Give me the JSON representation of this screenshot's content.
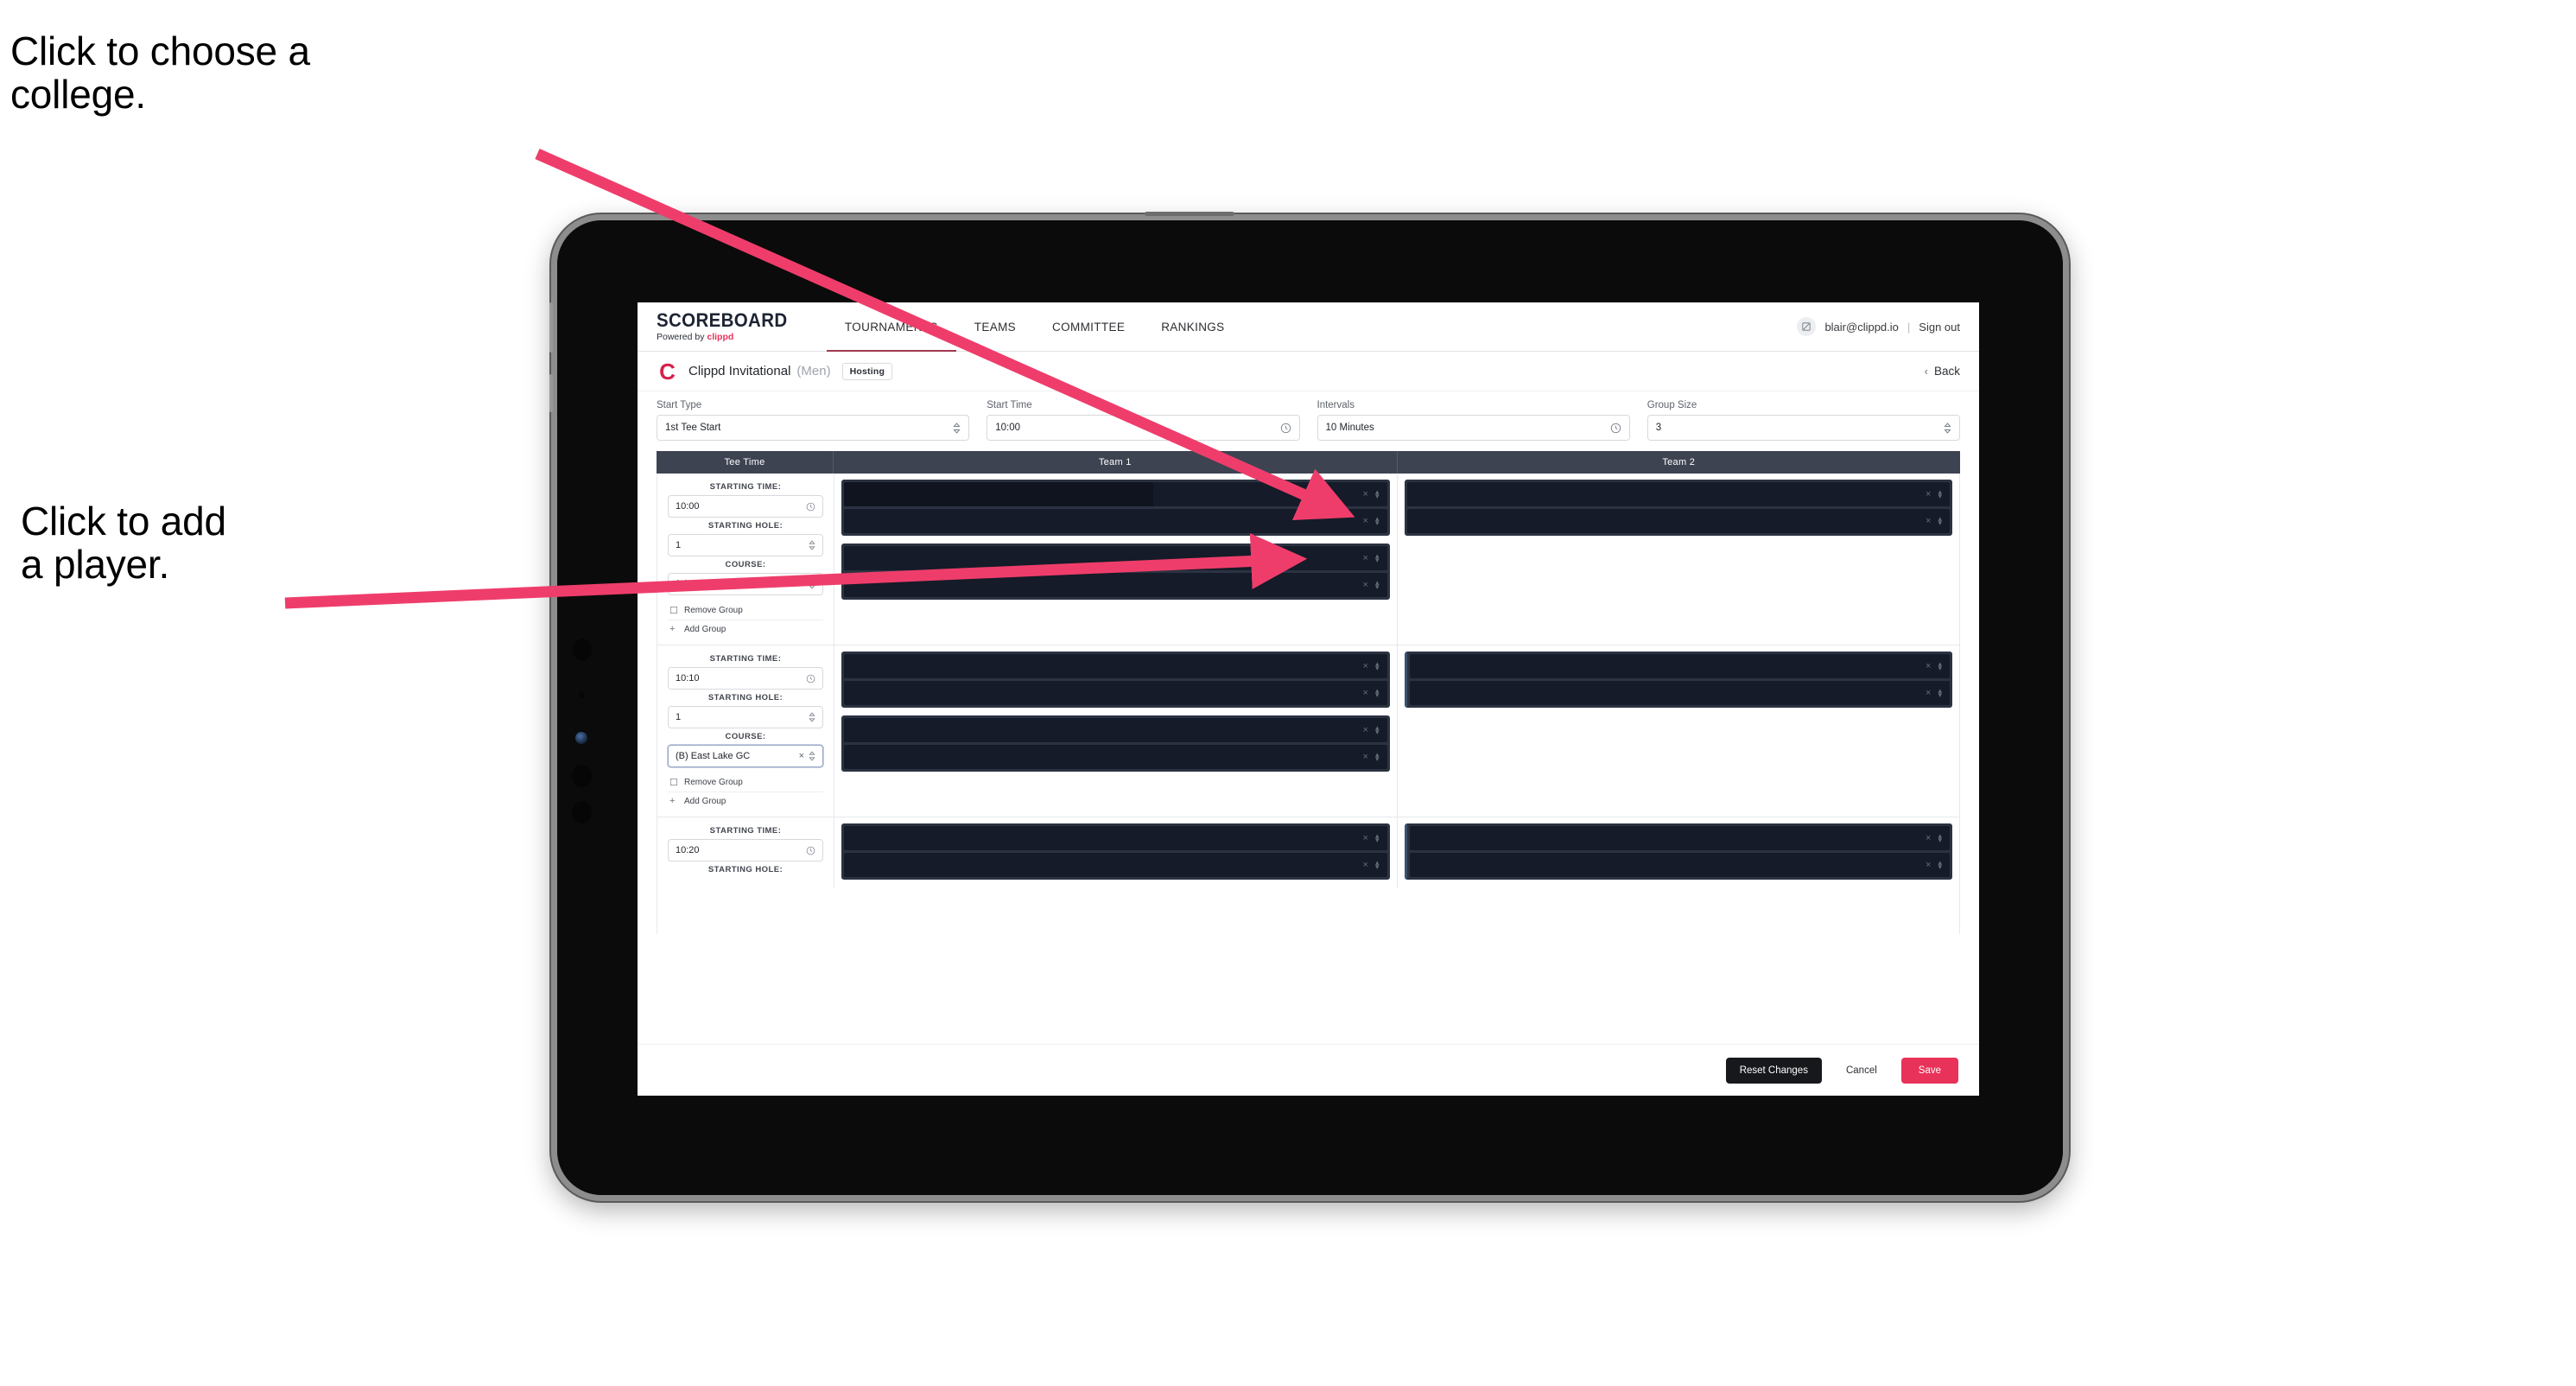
{
  "annotations": {
    "college": "Click to choose a\ncollege.",
    "player": "Click to add\na player."
  },
  "brand": {
    "name": "SCOREBOARD",
    "powered_prefix": "Powered by ",
    "powered_brand": "clippd"
  },
  "topnav": {
    "tabs": [
      {
        "label": "TOURNAMENTS",
        "active": true
      },
      {
        "label": "TEAMS",
        "active": false
      },
      {
        "label": "COMMITTEE",
        "active": false
      },
      {
        "label": "RANKINGS",
        "active": false
      }
    ],
    "avatar_icon": "user-avatar-icon",
    "email": "blair@clippd.io",
    "divider": "|",
    "signout": "Sign out"
  },
  "subheader": {
    "logo_letter": "C",
    "title": "Clippd Invitational",
    "gender": "(Men)",
    "chip": "Hosting",
    "back_chevron": "‹",
    "back_label": "Back"
  },
  "controls": [
    {
      "label": "Start Type",
      "value": "1st Tee Start",
      "icon": "chevron-updown-icon"
    },
    {
      "label": "Start Time",
      "value": "10:00",
      "icon": "clock-icon"
    },
    {
      "label": "Intervals",
      "value": "10 Minutes",
      "icon": "clock-icon"
    },
    {
      "label": "Group Size",
      "value": "3",
      "icon": "chevron-updown-icon"
    }
  ],
  "table": {
    "headers": [
      "Tee Time",
      "Team 1",
      "Team 2"
    ],
    "labels": {
      "starting_time": "STARTING TIME:",
      "starting_hole": "STARTING HOLE:",
      "course": "COURSE:",
      "remove_group": "Remove Group",
      "add_group": "Add Group",
      "remove_icon": "trash-icon",
      "add_icon": "plus-icon",
      "clock_icon": "clock-icon",
      "stepper_icon": "chevron-updown-icon",
      "clear_icon": "close-x-icon"
    },
    "groups": [
      {
        "starting_time": "10:00",
        "starting_hole": "1",
        "course": "(A) Peachtree GC",
        "course_focused": false,
        "team1": [
          {
            "slots": 2,
            "redact_widths": [
              57,
              0
            ],
            "focused": false
          },
          {
            "slots": 2,
            "redact_widths": [
              0,
              0
            ],
            "focused": false
          }
        ],
        "team2": [
          {
            "slots": 2,
            "redact_widths": [
              0,
              0
            ],
            "focused": false
          }
        ]
      },
      {
        "starting_time": "10:10",
        "starting_hole": "1",
        "course": "(B) East Lake GC",
        "course_focused": true,
        "team1": [
          {
            "slots": 2,
            "redact_widths": [
              0,
              0
            ],
            "focused": false
          },
          {
            "slots": 2,
            "redact_widths": [
              0,
              0
            ],
            "focused": false
          }
        ],
        "team2": [
          {
            "slots": 2,
            "redact_widths": [
              0,
              0
            ],
            "focused": true
          }
        ]
      },
      {
        "starting_time": "10:20",
        "starting_hole": "",
        "course": "",
        "course_focused": false,
        "team1": [
          {
            "slots": 2,
            "redact_widths": [
              0,
              0
            ],
            "focused": false
          }
        ],
        "team2": [
          {
            "slots": 2,
            "redact_widths": [
              0,
              0
            ],
            "focused": true
          }
        ]
      }
    ]
  },
  "footer": {
    "reset": "Reset Changes",
    "cancel": "Cancel",
    "save": "Save"
  },
  "colors": {
    "accent_pink": "#e8325a",
    "nav_active_underline": "#a1374f",
    "table_header_bg": "#3d4351",
    "slot_bg": "#151b28",
    "slot_group_bg": "#2b3241",
    "annotation_arrow": "#ef3d6b"
  }
}
